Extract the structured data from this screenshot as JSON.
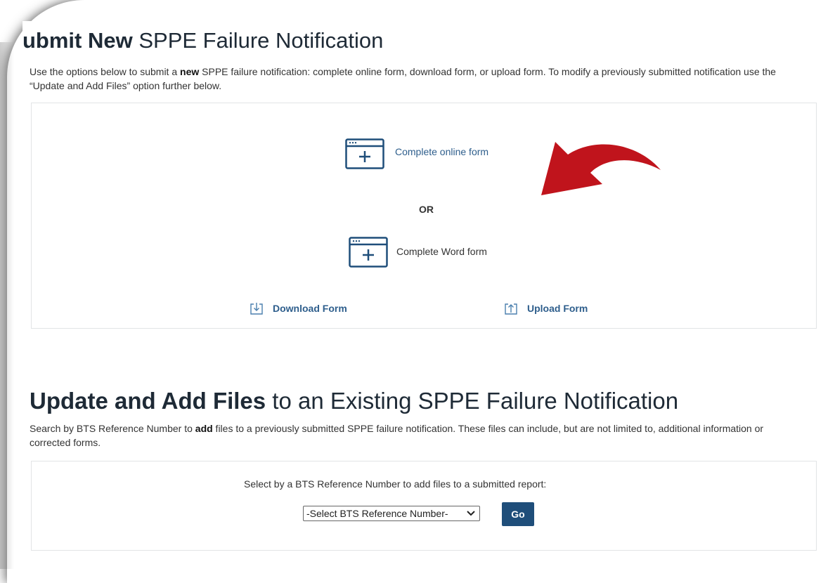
{
  "submit": {
    "title_bold": "ubmit New",
    "title_rest": " SPPE Failure Notification",
    "desc_a": "Use the options below to submit a ",
    "desc_bold": "new",
    "desc_b": " SPPE failure notification: complete online form, download form, or upload form. To modify a previously submitted notification use the “Update and Add Files” option further below.",
    "online_form_label": "Complete online form",
    "or_label": "OR",
    "word_form_label": "Complete Word form",
    "download_label": "Download Form",
    "upload_label": "Upload Form",
    "icons": [
      "window-plus-icon",
      "window-plus-icon",
      "download-icon",
      "upload-icon"
    ]
  },
  "annotation": {
    "arrow_color": "#c0141c"
  },
  "update": {
    "title_bold": "Update and Add Files",
    "title_rest": " to an Existing SPPE Failure Notification",
    "desc_a": "Search by BTS Reference Number to ",
    "desc_bold": "add",
    "desc_b": " files to a previously submitted SPPE failure notification. These files can include, but are not limited to, additional information or corrected forms.",
    "select_prompt": "Select by a BTS Reference Number to add files to a submitted report:",
    "select_value": "-Select BTS Reference Number-",
    "go_label": "Go"
  },
  "colors": {
    "link": "#2e5e8c",
    "button": "#1f4e7a",
    "heading": "#1e2a36"
  }
}
